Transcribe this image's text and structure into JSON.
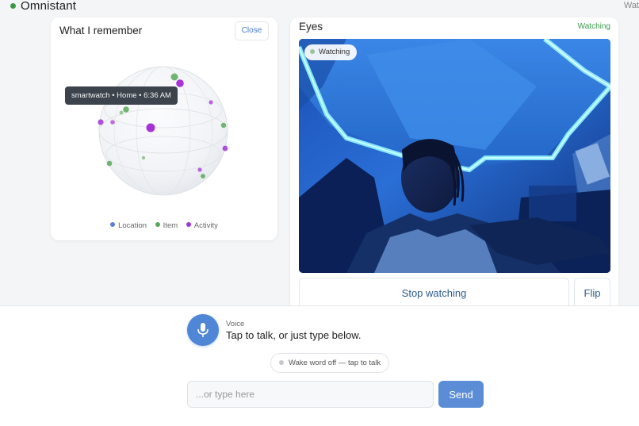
{
  "app": {
    "title": "Omnistant",
    "header_right": "Wat"
  },
  "memory": {
    "title": "What I remember",
    "close_label": "Close",
    "tooltip": "smartwatch • Home • 6:36 AM",
    "legend": [
      {
        "label": "Location",
        "color": "#5b7fd6"
      },
      {
        "label": "Item",
        "color": "#5aa85a"
      },
      {
        "label": "Activity",
        "color": "#a533d6"
      }
    ]
  },
  "eyes": {
    "title": "Eyes",
    "status": "Watching",
    "camera_badge": "Watching",
    "stop_label": "Stop watching",
    "flip_label": "Flip"
  },
  "voice": {
    "label": "Voice",
    "hint": "Tap to talk, or just type below.",
    "wake_label": "Wake word off — tap to talk"
  },
  "chat": {
    "placeholder": "...or type here",
    "value": "",
    "send_label": "Send"
  },
  "colors": {
    "accent": "#5b8dd6",
    "status_green": "#3a9a4a",
    "tooltip_bg": "#3c434d"
  }
}
